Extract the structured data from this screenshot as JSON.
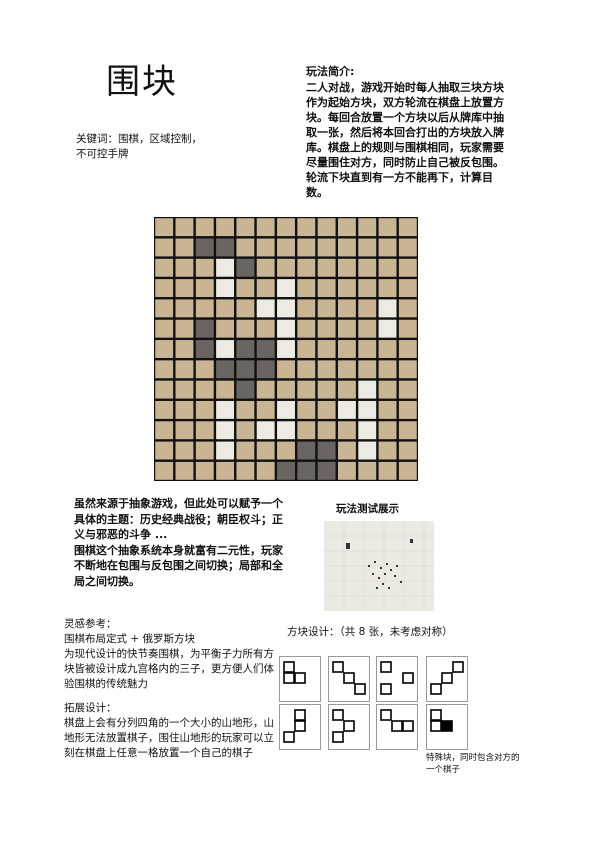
{
  "title": "围块",
  "keywords": "关键词：围棋，区域控制，\n不可控手牌",
  "rules": {
    "heading": "玩法简介:",
    "body": "二人对战，游戏开始时每人抽取三块方块作为起始方块，双方轮流在棋盘上放置方块。每回合放置一个方块以后从牌库中抽取一张，然后将本回合打出的方块放入牌库。棋盘上的规则与围棋相同，玩家需要尽量围住对方，同时防止自己被反包围。轮流下块直到有一方不能再下，计算目数。"
  },
  "board": {
    "size": 13,
    "colors": {
      "empty": "#c9b494",
      "dark": "#6a6562",
      "light": "#ecebe3",
      "line": "#111111"
    },
    "dark": [
      [
        1,
        2
      ],
      [
        1,
        3
      ],
      [
        2,
        4
      ],
      [
        5,
        2
      ],
      [
        6,
        2
      ],
      [
        6,
        4
      ],
      [
        6,
        5
      ],
      [
        7,
        3
      ],
      [
        7,
        4
      ],
      [
        7,
        5
      ],
      [
        8,
        4
      ],
      [
        11,
        7
      ],
      [
        11,
        8
      ],
      [
        12,
        6
      ],
      [
        12,
        7
      ],
      [
        12,
        8
      ]
    ],
    "light": [
      [
        2,
        3
      ],
      [
        3,
        3
      ],
      [
        3,
        6
      ],
      [
        4,
        5
      ],
      [
        4,
        6
      ],
      [
        4,
        11
      ],
      [
        5,
        6
      ],
      [
        5,
        11
      ],
      [
        6,
        3
      ],
      [
        6,
        6
      ],
      [
        8,
        10
      ],
      [
        9,
        3
      ],
      [
        9,
        6
      ],
      [
        9,
        9
      ],
      [
        9,
        10
      ],
      [
        10,
        3
      ],
      [
        10,
        5
      ],
      [
        10,
        6
      ],
      [
        10,
        10
      ],
      [
        11,
        3
      ],
      [
        11,
        10
      ]
    ]
  },
  "theme": {
    "p1": "虽然来源于抽象游戏，但此处可以赋予一个具体的主题：历史经典战役；朝臣权斗；正义与邪恶的斗争 ...",
    "p2": "围棋这个抽象系统本身就富有二元性，玩家不断地在包围与反包围之间切换；局部和全局之间切换。"
  },
  "test": {
    "label": "玩法测试展示"
  },
  "inspiration": {
    "heading": "灵感参考：",
    "line1": "围棋布局定式 + 俄罗斯方块",
    "line2": "为现代设计的快节奏围棋，为平衡子力所有方块皆被设计成九宫格内的三子，更方便人们体验围棋的传统魅力"
  },
  "expansion": {
    "heading": "拓展设计：",
    "body": "棋盘上会有分列四角的一个大小的山地形，山地形无法放置棋子，围住山地形的玩家可以立刻在棋盘上任意一格放置一个自己的棋子"
  },
  "pieces": {
    "title": "方块设计：（共 8 张，未考虑对称）",
    "shapes": [
      [
        [
          0,
          0
        ],
        [
          0,
          1
        ],
        [
          1,
          1
        ]
      ],
      [
        [
          0,
          0
        ],
        [
          1,
          1
        ],
        [
          2,
          2
        ]
      ],
      [
        [
          0,
          0
        ],
        [
          2,
          1
        ],
        [
          0,
          2
        ]
      ],
      [
        [
          0,
          2
        ],
        [
          1,
          1
        ],
        [
          2,
          0
        ]
      ],
      [
        [
          1,
          0
        ],
        [
          1,
          1
        ],
        [
          0,
          2
        ]
      ],
      [
        [
          0,
          0
        ],
        [
          1,
          1
        ],
        [
          0,
          2
        ]
      ],
      [
        [
          0,
          0
        ],
        [
          1,
          1
        ],
        [
          2,
          1
        ]
      ],
      [
        [
          0,
          0
        ],
        [
          0,
          1
        ],
        [
          1,
          1
        ]
      ]
    ],
    "special_filled": [
      1,
      1
    ],
    "special_note": "特殊块，同时包含对方的一个棋子"
  }
}
